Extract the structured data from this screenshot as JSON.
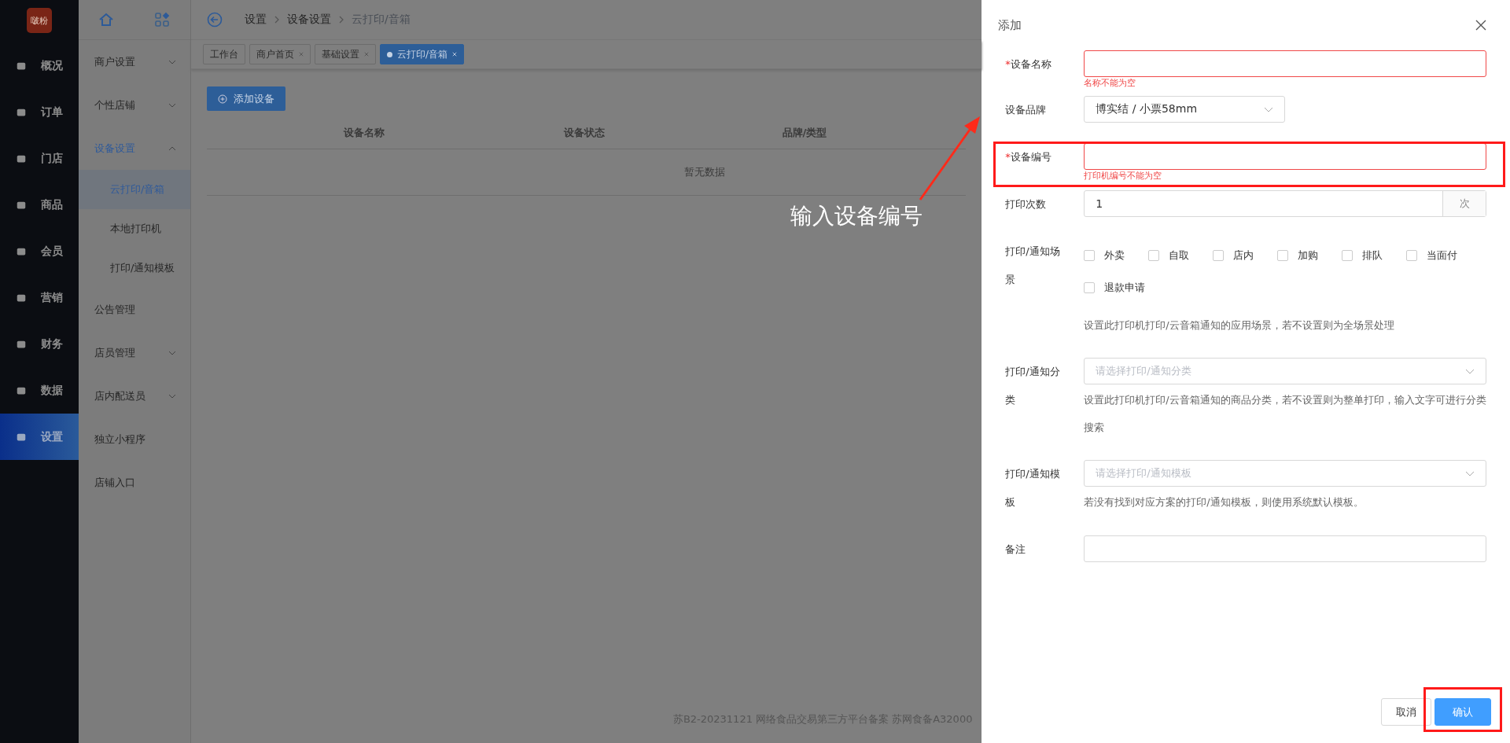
{
  "logo": {
    "text": "啵粉"
  },
  "sidebar": {
    "items": [
      {
        "label": "概况",
        "selected": false
      },
      {
        "label": "订单",
        "selected": false
      },
      {
        "label": "门店",
        "selected": false
      },
      {
        "label": "商品",
        "selected": false
      },
      {
        "label": "会员",
        "selected": false
      },
      {
        "label": "营销",
        "selected": false
      },
      {
        "label": "财务",
        "selected": false
      },
      {
        "label": "数据",
        "selected": false
      },
      {
        "label": "设置",
        "selected": true
      }
    ]
  },
  "submenu": {
    "items": [
      {
        "label": "商户设置",
        "expandable": true,
        "expanded": false,
        "selected": false
      },
      {
        "label": "个性店铺",
        "expandable": true,
        "expanded": false,
        "selected": false
      },
      {
        "label": "设备设置",
        "expandable": true,
        "expanded": true,
        "selected": true,
        "children": [
          {
            "label": "云打印/音箱",
            "selected": true
          },
          {
            "label": "本地打印机",
            "selected": false
          },
          {
            "label": "打印/通知模板",
            "selected": false
          }
        ]
      },
      {
        "label": "公告管理",
        "expandable": false,
        "selected": false
      },
      {
        "label": "店员管理",
        "expandable": true,
        "expanded": false,
        "selected": false
      },
      {
        "label": "店内配送员",
        "expandable": true,
        "expanded": false,
        "selected": false
      },
      {
        "label": "独立小程序",
        "expandable": false,
        "selected": false
      },
      {
        "label": "店铺入口",
        "expandable": false,
        "selected": false
      }
    ]
  },
  "breadcrumb": [
    "设置",
    "设备设置",
    "云打印/音箱"
  ],
  "tabs": [
    {
      "label": "工作台",
      "selected": false,
      "closable": false
    },
    {
      "label": "商户首页",
      "selected": false,
      "closable": true
    },
    {
      "label": "基础设置",
      "selected": false,
      "closable": true
    },
    {
      "label": "云打印/音箱",
      "selected": true,
      "closable": true
    }
  ],
  "add_button": "添加设备",
  "table": {
    "columns": [
      "设备名称",
      "设备状态",
      "品牌/类型"
    ],
    "empty": "暂无数据"
  },
  "footer": "苏B2-20231121  网络食品交易第三方平台备案 苏网食备A32000",
  "annotation": {
    "text": "输入设备编号"
  },
  "drawer": {
    "title": "添加",
    "fields": [
      {
        "kind": "input",
        "label": "设备名称",
        "required_mark": "*",
        "error": "名称不能为空",
        "highlighted": false
      },
      {
        "kind": "select",
        "label": "设备品牌",
        "value": "博实结 / 小票58mm",
        "highlighted": false
      },
      {
        "kind": "input",
        "label": "设备编号",
        "required_mark": "*",
        "error": "打印机编号不能为空",
        "highlighted": true
      },
      {
        "kind": "number",
        "label": "打印次数",
        "value": "1",
        "suffix": "次",
        "highlighted": false
      },
      {
        "kind": "checks",
        "label": "打印/通知场景",
        "highlighted": false,
        "options": [
          {
            "label": "外卖",
            "checked": false
          },
          {
            "label": "自取",
            "checked": false
          },
          {
            "label": "店内",
            "checked": false
          },
          {
            "label": "加购",
            "checked": false
          },
          {
            "label": "排队",
            "checked": false
          },
          {
            "label": "当面付",
            "checked": false
          },
          {
            "label": "退款申请",
            "checked": false
          }
        ],
        "hint": "设置此打印机打印/云音箱通知的应用场景，若不设置则为全场景处理"
      },
      {
        "kind": "select",
        "label": "打印/通知分类",
        "placeholder": "请选择打印/通知分类",
        "hint": "设置此打印机打印/云音箱通知的商品分类，若不设置则为整单打印，输入文字可进行分类搜索",
        "highlighted": false
      },
      {
        "kind": "select",
        "label": "打印/通知模板",
        "placeholder": "请选择打印/通知模板",
        "hint": "若没有找到对应方案的打印/通知模板，则使用系统默认模板。",
        "highlighted": false
      },
      {
        "kind": "input",
        "label": "备注",
        "highlighted": false
      }
    ],
    "buttons": [
      {
        "kind": "default",
        "label": "取消",
        "highlighted": false
      },
      {
        "kind": "primary",
        "label": "确认",
        "highlighted": true
      }
    ]
  }
}
